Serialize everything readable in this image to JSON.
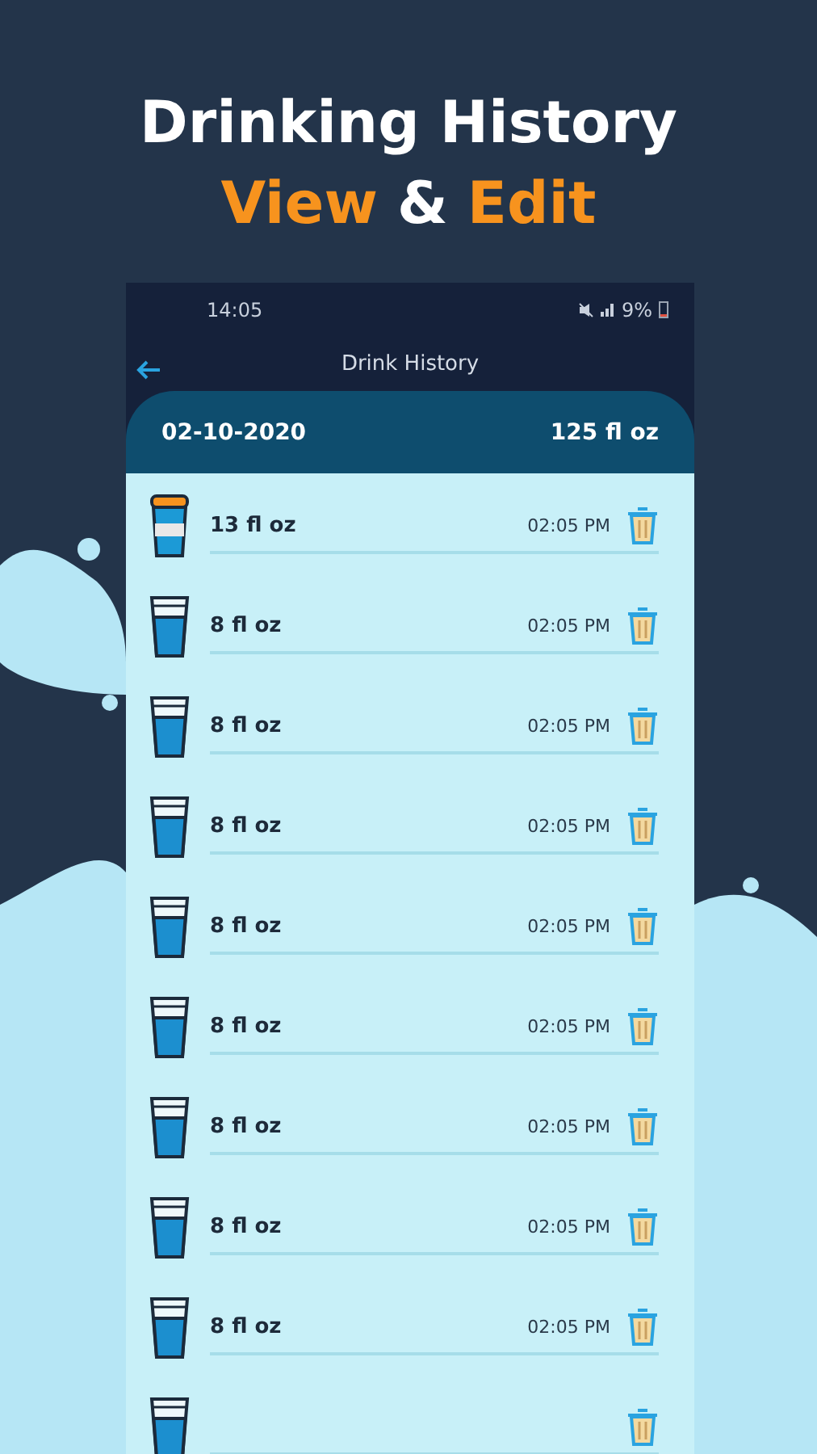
{
  "headline": {
    "title": "Drinking History",
    "subtitle": [
      {
        "text": "View",
        "highlight": true
      },
      {
        "text": "&",
        "highlight": false
      },
      {
        "text": "Edit",
        "highlight": true
      }
    ]
  },
  "status_bar": {
    "time": "14:05",
    "battery": "9%"
  },
  "toolbar": {
    "title": "Drink History"
  },
  "day": {
    "date": "02-10-2020",
    "total": "125 fl oz"
  },
  "entries": [
    {
      "kind": "cup",
      "amount": "13 fl oz",
      "time": "02:05 PM"
    },
    {
      "kind": "glass",
      "amount": "8 fl oz",
      "time": "02:05 PM"
    },
    {
      "kind": "glass",
      "amount": "8 fl oz",
      "time": "02:05 PM"
    },
    {
      "kind": "glass",
      "amount": "8 fl oz",
      "time": "02:05 PM"
    },
    {
      "kind": "glass",
      "amount": "8 fl oz",
      "time": "02:05 PM"
    },
    {
      "kind": "glass",
      "amount": "8 fl oz",
      "time": "02:05 PM"
    },
    {
      "kind": "glass",
      "amount": "8 fl oz",
      "time": "02:05 PM"
    },
    {
      "kind": "glass",
      "amount": "8 fl oz",
      "time": "02:05 PM"
    },
    {
      "kind": "glass",
      "amount": "8 fl oz",
      "time": "02:05 PM"
    },
    {
      "kind": "glass"
    }
  ]
}
